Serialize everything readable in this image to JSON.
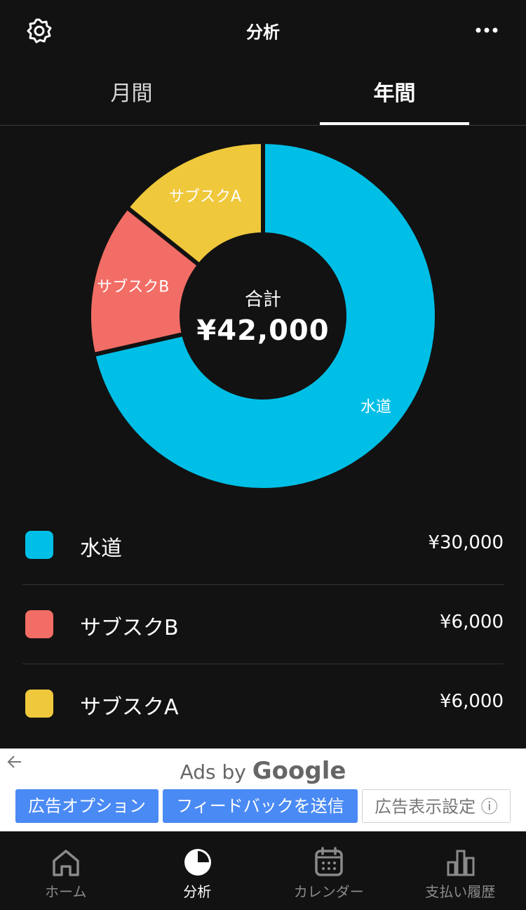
{
  "header": {
    "title": "分析",
    "settings_icon": "gear-icon",
    "more_icon": "more-horizontal-icon"
  },
  "tabs": [
    {
      "label": "月間",
      "active": false
    },
    {
      "label": "年間",
      "active": true
    }
  ],
  "chart_data": {
    "type": "pie",
    "categories": [
      "水道",
      "サブスクB",
      "サブスクA"
    ],
    "values": [
      30000,
      6000,
      6000
    ],
    "colors": [
      "#00BFE6",
      "#F26D65",
      "#EFC83C"
    ],
    "center_caption": "合計",
    "center_total": "¥42,000"
  },
  "legend": [
    {
      "name": "水道",
      "value": "¥30,000",
      "color": "#00BFE6"
    },
    {
      "name": "サブスクB",
      "value": "¥6,000",
      "color": "#F26D65"
    },
    {
      "name": "サブスクA",
      "value": "¥6,000",
      "color": "#EFC83C"
    }
  ],
  "ad": {
    "brand_prefix": "Ads by",
    "brand_name": "Google",
    "back_icon": "arrow-left-icon",
    "buttons": [
      {
        "label": "広告オプション",
        "style": "blue"
      },
      {
        "label": "フィードバックを送信",
        "style": "blue"
      },
      {
        "label": "広告表示設定 ⓘ",
        "style": "outline"
      }
    ]
  },
  "nav": [
    {
      "label": "ホーム",
      "icon": "home-icon",
      "active": false
    },
    {
      "label": "分析",
      "icon": "pie-chart-icon",
      "active": true
    },
    {
      "label": "カレンダー",
      "icon": "calendar-icon",
      "active": false
    },
    {
      "label": "支払い履歴",
      "icon": "bar-chart-icon",
      "active": false
    }
  ]
}
